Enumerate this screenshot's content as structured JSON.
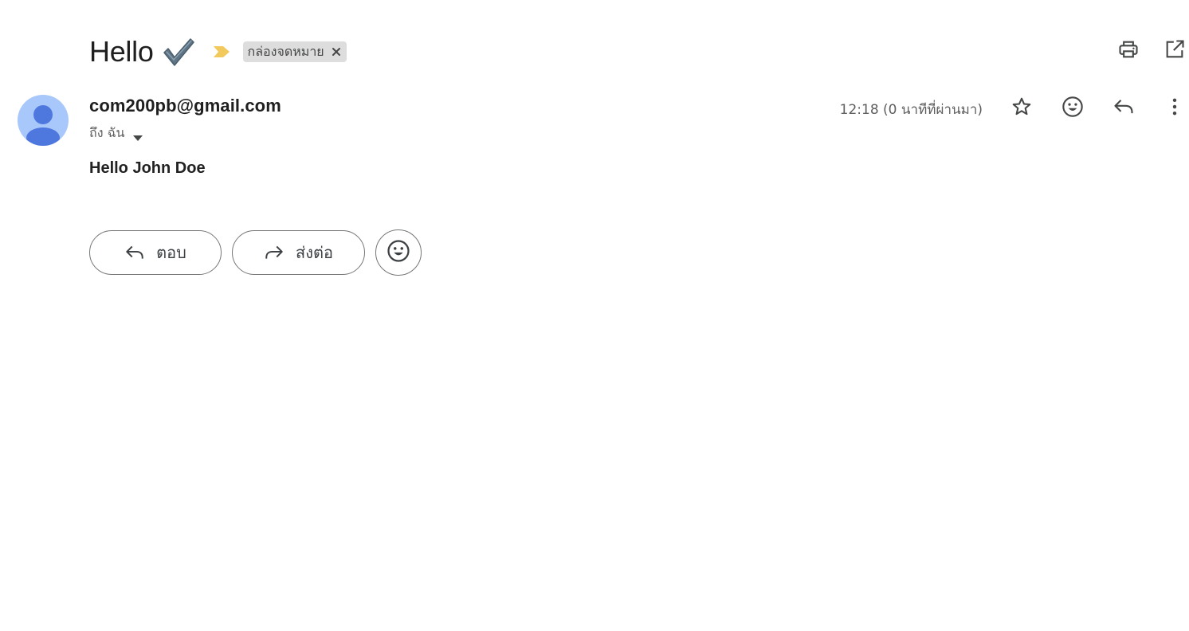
{
  "subject": {
    "title": "Hello",
    "emoji": "heavy-check-mark",
    "importance_marker_color": "#f2c95c",
    "label_chip": "กล่องจดหมาย",
    "label_chip_bg": "#dddddd"
  },
  "top_actions": {
    "print_icon": "print-icon",
    "open_new_window_icon": "open-in-new-icon"
  },
  "message": {
    "sender": "com200pb@gmail.com",
    "recipient_label": "ถึง ฉัน",
    "timestamp": "12:18 (0 นาทีที่ผ่านมา)",
    "body": "Hello John Doe",
    "avatar_bg": "#a8c7fa",
    "avatar_fg": "#4f78de",
    "actions": [
      "star-icon",
      "emoji-icon",
      "reply-icon",
      "more-vert-icon"
    ]
  },
  "bottom_actions": {
    "reply_label": "ตอบ",
    "forward_label": "ส่งต่อ",
    "emoji_icon": "add-reaction-icon"
  }
}
